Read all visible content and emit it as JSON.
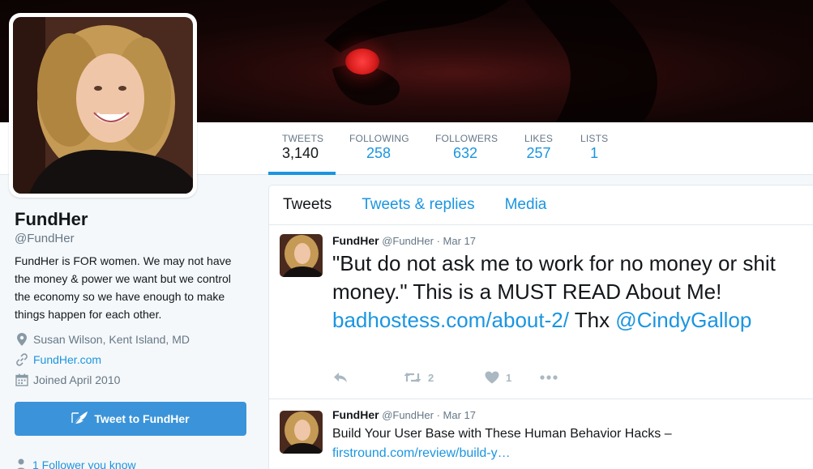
{
  "profile": {
    "name": "FundHer",
    "handle": "@FundHer",
    "bio": "FundHer is FOR women. We may not have the money & power we want but we control the economy so we have enough to make things happen for each other.",
    "location": "Susan Wilson, Kent Island, MD",
    "website": "FundHer.com",
    "joined": "Joined April 2010",
    "tweet_to_label": "Tweet to FundHer",
    "followers_you_know": "1 Follower you know"
  },
  "stats": [
    {
      "label": "TWEETS",
      "value": "3,140"
    },
    {
      "label": "FOLLOWING",
      "value": "258"
    },
    {
      "label": "FOLLOWERS",
      "value": "632"
    },
    {
      "label": "LIKES",
      "value": "257"
    },
    {
      "label": "LISTS",
      "value": "1"
    }
  ],
  "timeline": {
    "tabs": [
      "Tweets",
      "Tweets & replies",
      "Media"
    ],
    "tweets": [
      {
        "name": "FundHer",
        "handle": "@FundHer",
        "date": "· Mar 17",
        "text_before": "\"But do not ask me to work for no money or shit money.\" This is a MUST READ About Me!  ",
        "link": "badhostess.com/about-2/",
        "text_middle": " Thx ",
        "mention": "@CindyGallop",
        "retweets": "2",
        "likes": "1"
      },
      {
        "name": "FundHer",
        "handle": "@FundHer",
        "date": "· Mar 17",
        "text_before": "Build Your User Base with These Human Behavior Hacks –",
        "link": "firstround.com/review/build-y…"
      }
    ]
  },
  "colors": {
    "accent": "#1b95e0",
    "button": "#3b94d9",
    "muted": "#657786"
  },
  "icons": [
    "location-icon",
    "link-icon",
    "calendar-icon",
    "feather-icon",
    "reply-icon",
    "retweet-icon",
    "heart-icon",
    "more-icon",
    "person-icon"
  ]
}
